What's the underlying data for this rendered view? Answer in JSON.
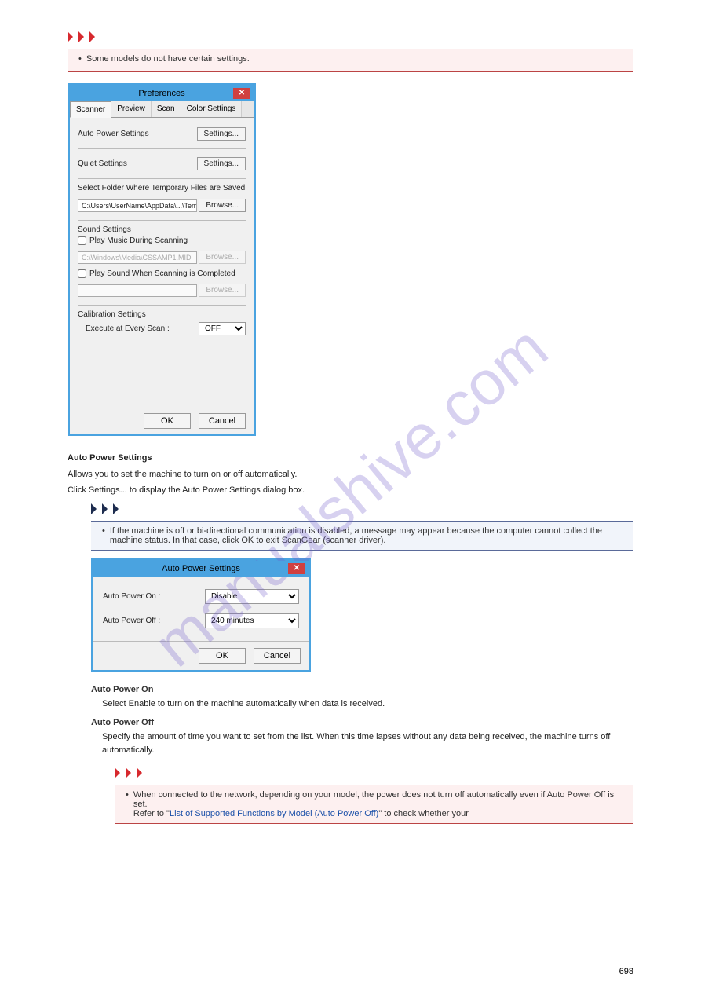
{
  "watermark": "manualshive.com",
  "important1": {
    "line": "Some models do not have certain settings."
  },
  "pref": {
    "title": "Preferences",
    "tabs": [
      "Scanner",
      "Preview",
      "Scan",
      "Color Settings"
    ],
    "auto_power": {
      "label": "Auto Power Settings",
      "button": "Settings..."
    },
    "quiet": {
      "label": "Quiet Settings",
      "button": "Settings..."
    },
    "folder": {
      "label": "Select Folder Where Temporary Files are Saved",
      "path": "C:\\Users\\UserName\\AppData\\...\\Temp\\",
      "button": "Browse..."
    },
    "sound": {
      "label": "Sound Settings",
      "play_music": "Play Music During Scanning",
      "music_path": "C:\\Windows\\Media\\CSSAMP1.MID",
      "browse1": "Browse...",
      "play_complete": "Play Sound When Scanning is Completed",
      "browse2": "Browse..."
    },
    "calibration": {
      "label": "Calibration Settings",
      "sublabel": "Execute at Every Scan :",
      "value": "OFF"
    },
    "ok": "OK",
    "cancel": "Cancel"
  },
  "section_auto": {
    "heading": "Auto Power Settings",
    "text": "Allows you to set the machine to turn on or off automatically.",
    "click": "Click Settings... to display the Auto Power Settings dialog box.",
    "note_line1": "If the machine is off or bi-directional communication is disabled, a message may appear because",
    "note_line2": "the computer cannot collect the machine status. In that case, click OK to exit ScanGear (scanner",
    "note_line3": "driver)."
  },
  "auto_window": {
    "title": "Auto Power Settings",
    "on_label": "Auto Power On :",
    "on_value": "Disable",
    "off_label": "Auto Power Off :",
    "off_value": "240 minutes",
    "ok": "OK",
    "cancel": "Cancel"
  },
  "auto_on_desc": {
    "label": "Auto Power On",
    "text": "Select Enable to turn on the machine automatically when data is received."
  },
  "auto_off_desc": {
    "label": "Auto Power Off",
    "text": "Specify the amount of time you want to set from the list. When this time lapses without any data being received, the machine turns off automatically."
  },
  "important2": {
    "line1": "When connected to the network, depending on your model, the power does not turn",
    "line2": "off automatically even if Auto Power Off is set.",
    "line3_prefix": "Refer to \"",
    "link": "List of Supported Functions by Model (Auto Power Off)",
    "line3_suffix": "\" to check whether your"
  },
  "page_number": "698"
}
